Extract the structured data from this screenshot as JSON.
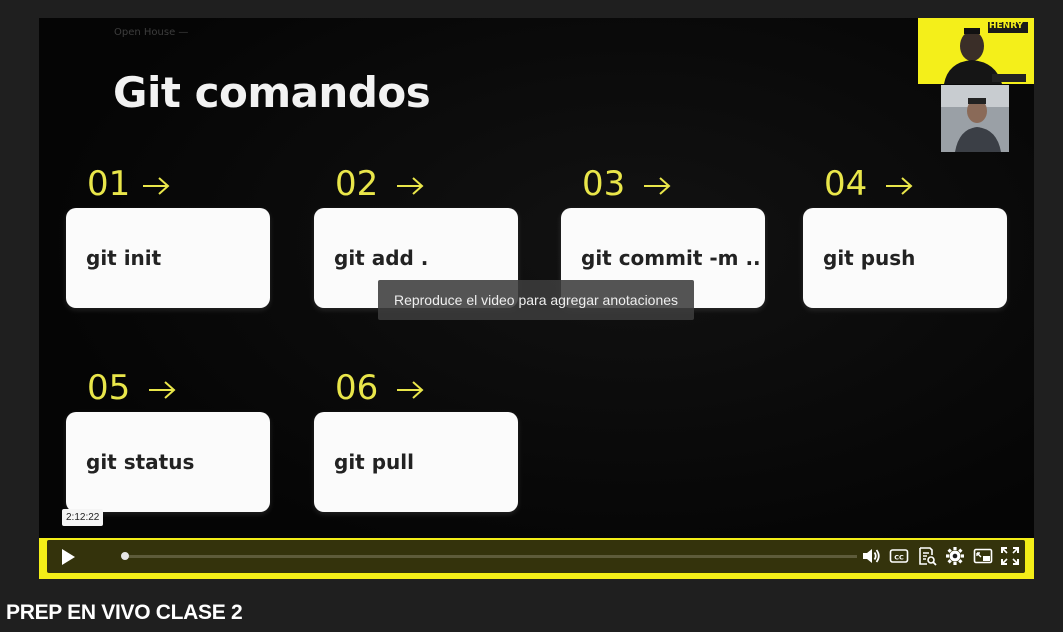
{
  "video": {
    "brand_line": "Open House —",
    "slide_title": "Git comandos",
    "steps": [
      {
        "number": "01",
        "command": "git init"
      },
      {
        "number": "02",
        "command": "git add ."
      },
      {
        "number": "03",
        "command": "git commit -m .."
      },
      {
        "number": "04",
        "command": "git push"
      },
      {
        "number": "05",
        "command": "git status"
      },
      {
        "number": "06",
        "command": "git pull"
      }
    ],
    "notice": "Reproduce el video para agregar anotaciones",
    "time_tooltip": "2:12:22",
    "progress": 0.0,
    "accent_color": "#f3ee18",
    "webcam_brand": "HENRY",
    "icons": [
      "play-icon",
      "volume-icon",
      "closed-captions-icon",
      "transcript-icon",
      "settings-icon",
      "picture-in-picture-icon",
      "fullscreen-icon"
    ]
  },
  "page": {
    "video_title": "PREP EN VIVO CLASE 2"
  }
}
